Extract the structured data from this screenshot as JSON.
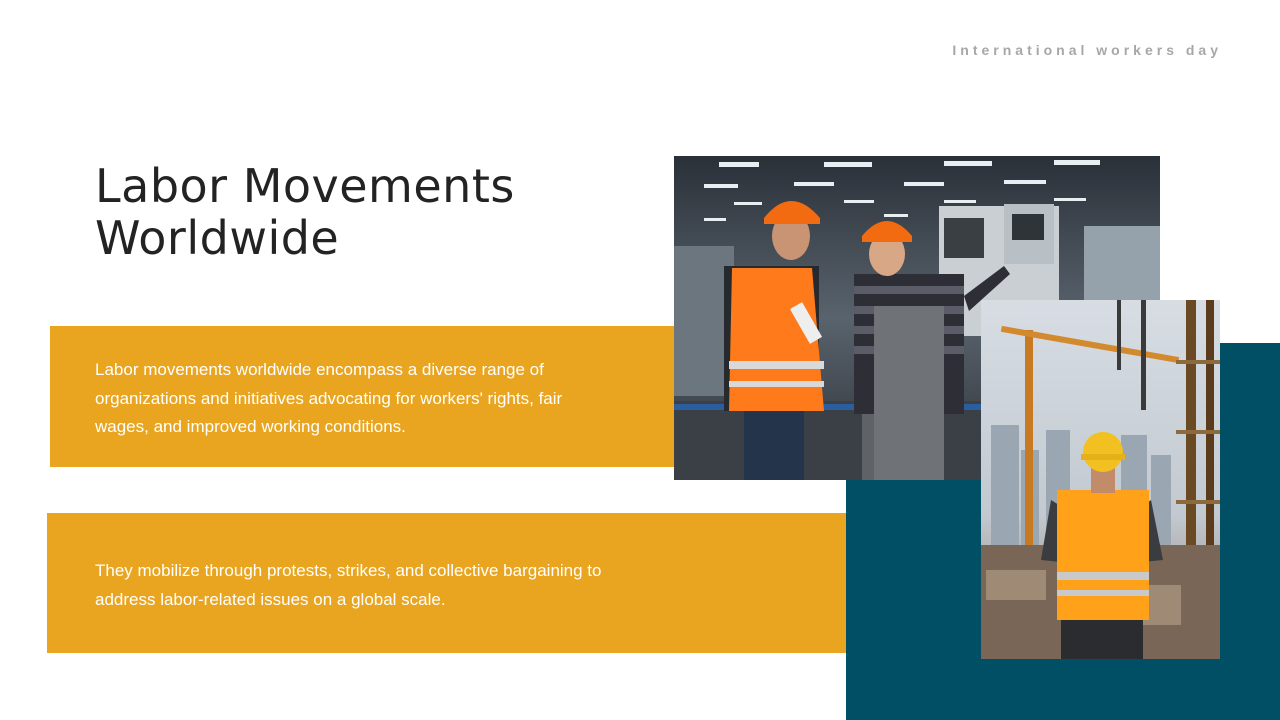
{
  "header": {
    "tag": "International workers day"
  },
  "slide": {
    "title_line1": "Labor Movements",
    "title_line2": "Worldwide",
    "paragraph1": "Labor movements worldwide encompass a diverse range of organizations and initiatives advocating for workers' rights, fair wages, and improved working conditions.",
    "paragraph2": "They mobilize through protests, strikes, and collective bargaining to address labor-related issues on a global scale."
  },
  "colors": {
    "accent_yellow": "#e9a51f",
    "accent_teal": "#004f64",
    "title_text": "#232323",
    "tag_text": "#a7a7a7"
  }
}
